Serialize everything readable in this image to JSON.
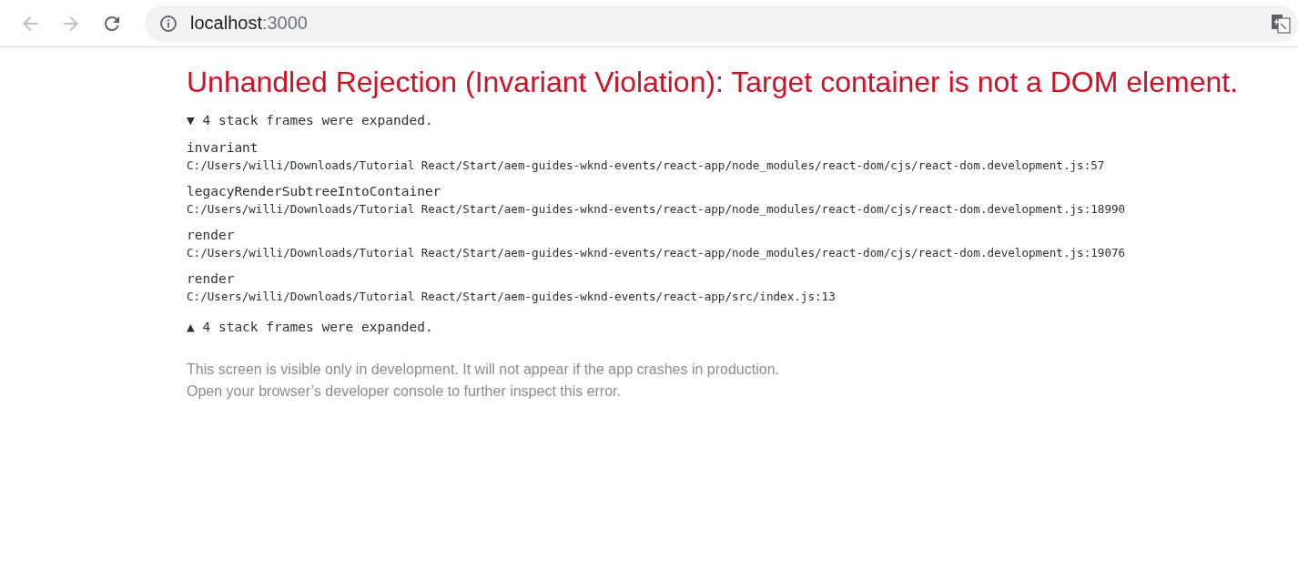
{
  "browser": {
    "back": {
      "disabled": true
    },
    "forward": {
      "disabled": true
    },
    "address": {
      "host": "localhost",
      "port": ":3000"
    }
  },
  "error": {
    "title": "Unhandled Rejection (Invariant Violation): Target container is not a DOM element.",
    "toggle_top": "▼ 4 stack frames were expanded.",
    "frames": [
      {
        "name": "invariant",
        "location": "C:/Users/willi/Downloads/Tutorial React/Start/aem-guides-wknd-events/react-app/node_modules/react-dom/cjs/react-dom.development.js:57"
      },
      {
        "name": "legacyRenderSubtreeIntoContainer",
        "location": "C:/Users/willi/Downloads/Tutorial React/Start/aem-guides-wknd-events/react-app/node_modules/react-dom/cjs/react-dom.development.js:18990"
      },
      {
        "name": "render",
        "location": "C:/Users/willi/Downloads/Tutorial React/Start/aem-guides-wknd-events/react-app/node_modules/react-dom/cjs/react-dom.development.js:19076"
      },
      {
        "name": "render",
        "location": "C:/Users/willi/Downloads/Tutorial React/Start/aem-guides-wknd-events/react-app/src/index.js:13"
      }
    ],
    "toggle_bottom": "▲ 4 stack frames were expanded.",
    "footer": [
      "This screen is visible only in development. It will not appear if the app crashes in production.",
      "Open your browser’s developer console to further inspect this error."
    ]
  }
}
